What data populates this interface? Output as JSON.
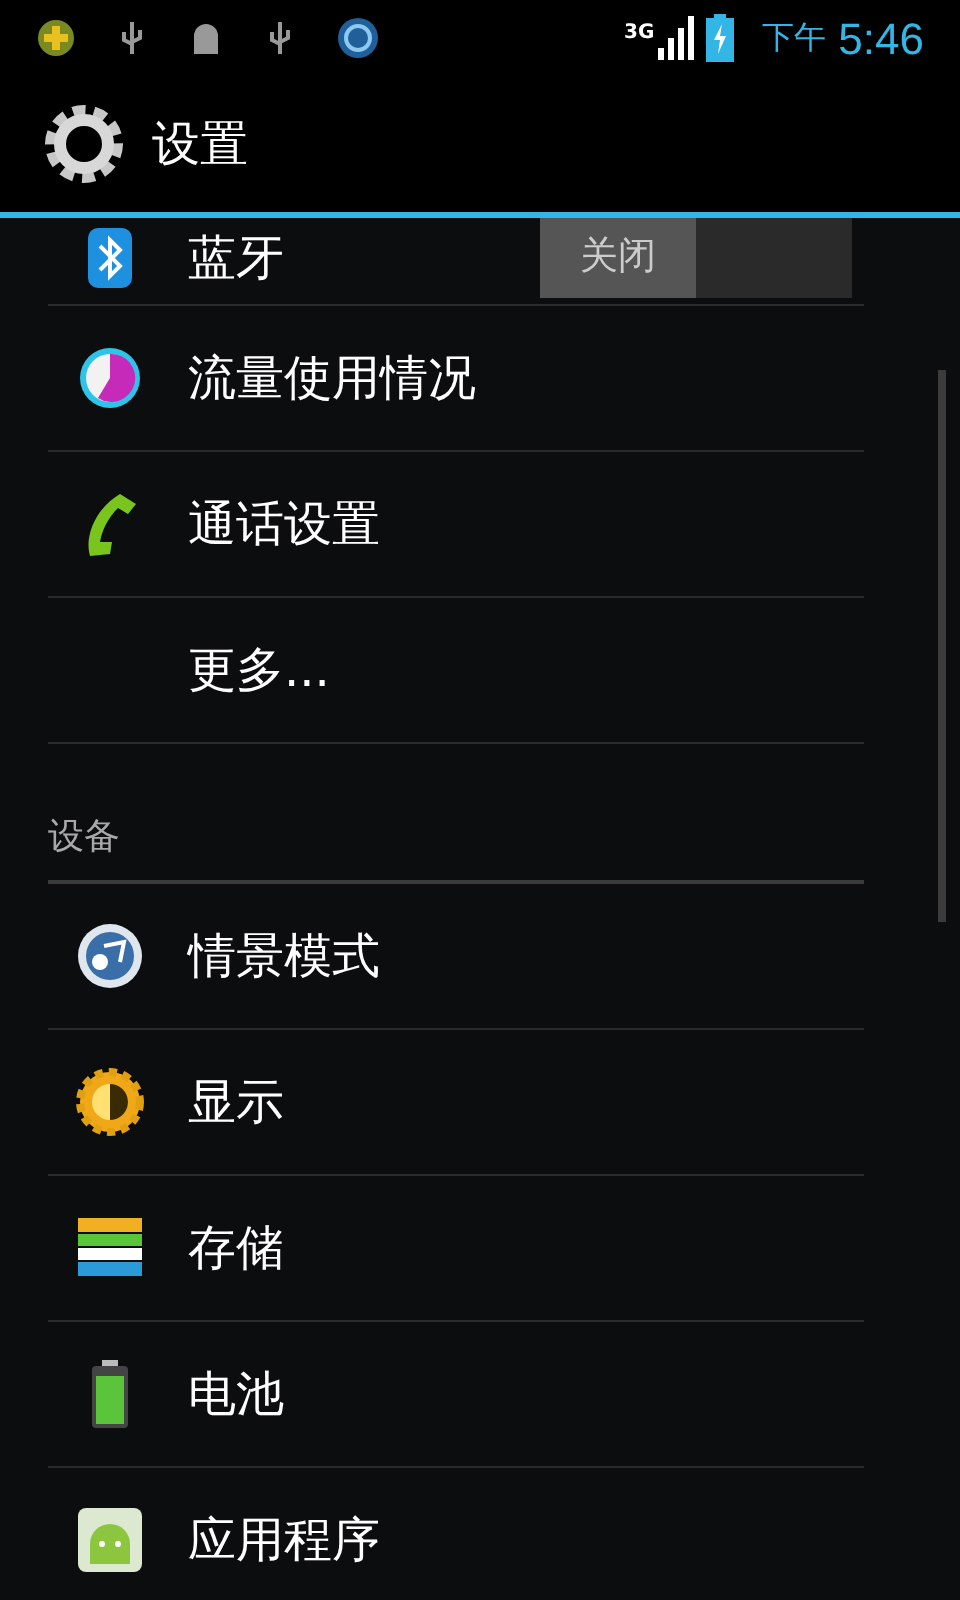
{
  "status_bar": {
    "network": "3G",
    "ampm": "下午",
    "time": "5:46"
  },
  "action_bar": {
    "title": "设置"
  },
  "list": [
    {
      "kind": "toggle",
      "label": "蓝牙",
      "toggle": {
        "label": "关闭",
        "on": false
      }
    },
    {
      "kind": "item",
      "label": "流量使用情况"
    },
    {
      "kind": "item",
      "label": "通话设置"
    },
    {
      "kind": "item",
      "label": "更多..."
    },
    {
      "kind": "header",
      "label": "设备"
    },
    {
      "kind": "item",
      "label": "情景模式"
    },
    {
      "kind": "item",
      "label": "显示"
    },
    {
      "kind": "item",
      "label": "存储"
    },
    {
      "kind": "item",
      "label": "电池"
    },
    {
      "kind": "item",
      "label": "应用程序"
    }
  ]
}
